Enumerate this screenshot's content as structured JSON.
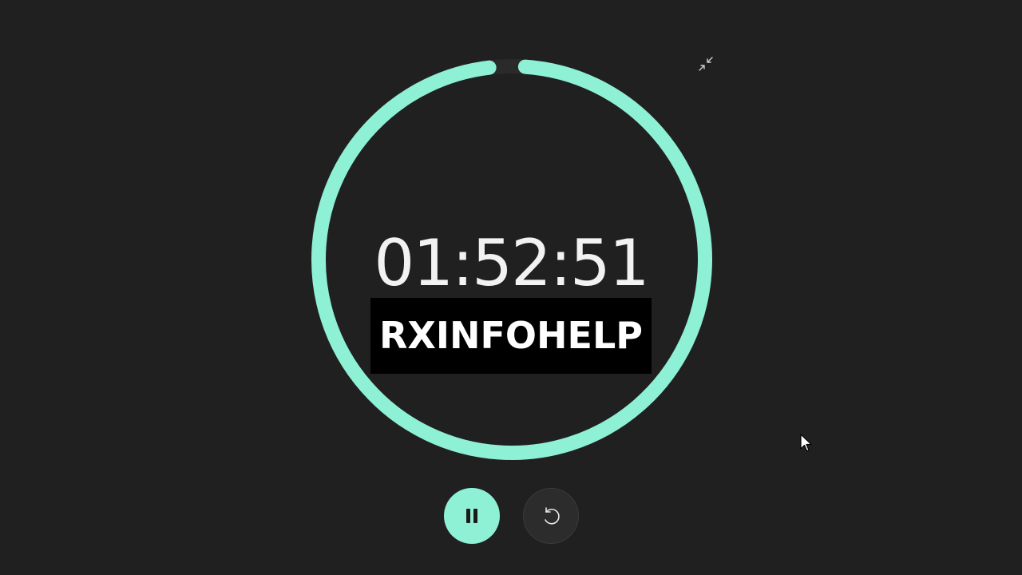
{
  "timer": {
    "time": "01:52:51",
    "progress_fraction": 0.97
  },
  "watermark": {
    "text": "RXINFOHELP"
  },
  "controls": {
    "pause_icon": "pause-icon",
    "reset_icon": "reset-icon",
    "collapse_icon": "collapse-icon"
  },
  "colors": {
    "background": "#202020",
    "accent": "#8ef0d4",
    "track": "#2a2a2a",
    "text": "#f2f2f2"
  }
}
